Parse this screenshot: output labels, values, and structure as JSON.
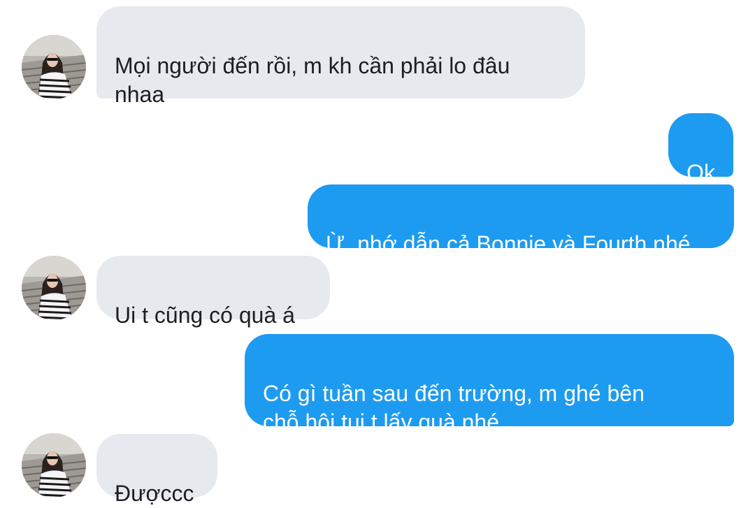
{
  "messages": [
    {
      "sender": "other",
      "text": "Mọi người đến rồi, m kh cần phải lo đâu\nnhaa"
    },
    {
      "sender": "me",
      "text": "Ok"
    },
    {
      "sender": "me",
      "text": "Ừ, nhớ dẫn cả Bonnie và Fourth nhé"
    },
    {
      "sender": "other",
      "text": "Ui t cũng có quà á"
    },
    {
      "sender": "me",
      "text": "Có gì tuần sau đến trường, m ghé bên\nchỗ hội tụi t lấy quà nhé"
    },
    {
      "sender": "other",
      "text": "Đượccc"
    }
  ],
  "colors": {
    "incoming_bubble": "#e6eaee",
    "outgoing_bubble": "#1d9bf0",
    "incoming_text": "#1c1e21",
    "outgoing_text": "#ffffff"
  },
  "icons": {
    "avatar": "profile-photo-avatar"
  }
}
